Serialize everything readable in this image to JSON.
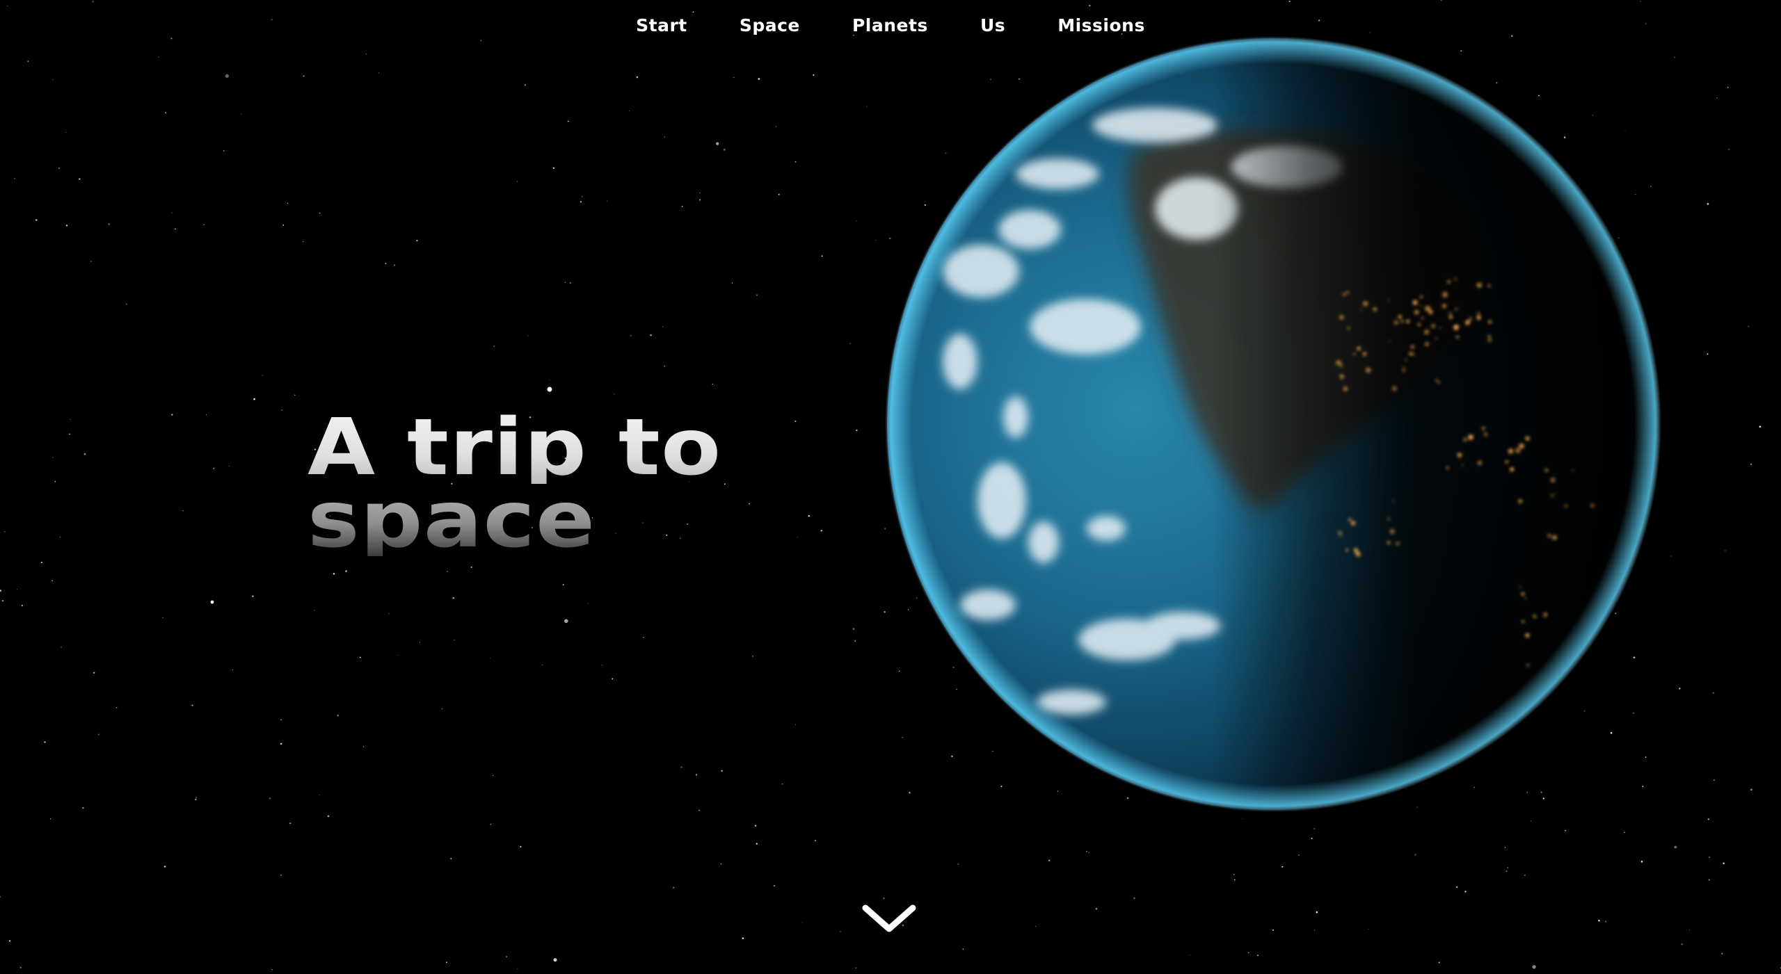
{
  "nav": {
    "items": [
      {
        "label": "Start"
      },
      {
        "label": "Space"
      },
      {
        "label": "Planets"
      },
      {
        "label": "Us"
      },
      {
        "label": "Missions"
      }
    ]
  },
  "hero": {
    "line1": "A trip to",
    "line2": "space"
  },
  "icons": {
    "scroll": "chevron-down-icon"
  },
  "colors": {
    "background": "#000000",
    "nav_text": "#ffffff",
    "ocean": "#1e7fa8",
    "atmosphere": "#4fd0ff",
    "city_lights": "#f0a040"
  }
}
